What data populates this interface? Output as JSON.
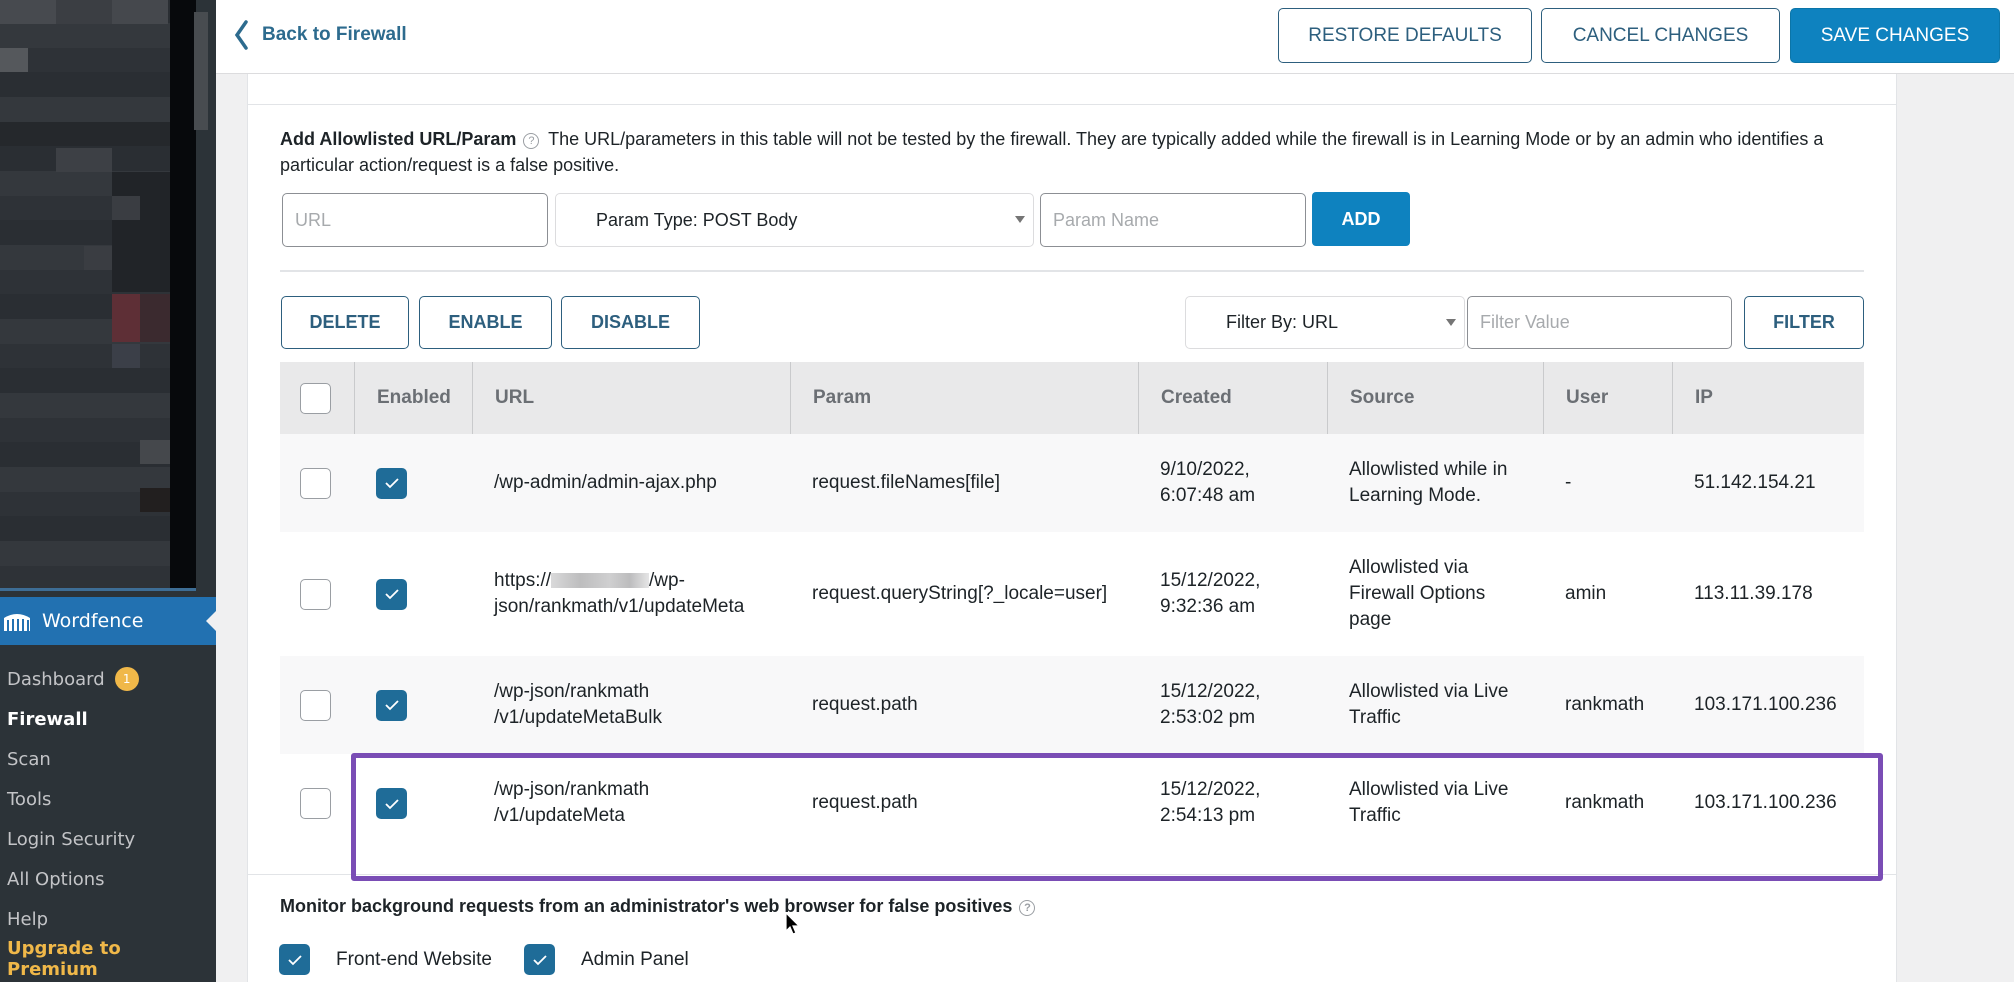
{
  "sidebar": {
    "plugin_name": "Wordfence",
    "items": [
      {
        "label": "Dashboard",
        "badge": "1"
      },
      {
        "label": "Firewall",
        "active": true
      },
      {
        "label": "Scan"
      },
      {
        "label": "Tools"
      },
      {
        "label": "Login Security"
      },
      {
        "label": "All Options"
      },
      {
        "label": "Help"
      },
      {
        "label": "Upgrade to Premium",
        "highlight": true
      }
    ]
  },
  "topbar": {
    "back_label": "Back to Firewall",
    "restore_label": "RESTORE DEFAULTS",
    "cancel_label": "CANCEL CHANGES",
    "save_label": "SAVE CHANGES"
  },
  "allowlist": {
    "title": "Add Allowlisted URL/Param",
    "help_glyph": "?",
    "description": "The URL/parameters in this table will not be tested by the firewall. They are typically added while the firewall is in Learning Mode or by an admin who identifies a particular action/request is a false positive.",
    "url_placeholder": "URL",
    "param_type_selected": "Param Type: POST Body",
    "param_name_placeholder": "Param Name",
    "add_label": "ADD"
  },
  "table_actions": {
    "delete_label": "DELETE",
    "enable_label": "ENABLE",
    "disable_label": "DISABLE",
    "filter_by_selected": "Filter By: URL",
    "filter_value_placeholder": "Filter Value",
    "filter_label": "FILTER"
  },
  "table": {
    "columns": [
      "",
      "Enabled",
      "URL",
      "Param",
      "Created",
      "Source",
      "User",
      "IP"
    ],
    "rows": [
      {
        "selected": false,
        "enabled": true,
        "url_line1": "/wp-admin/admin-ajax.php",
        "url_line2": "",
        "url_redacted": false,
        "param": "request.fileNames[file]",
        "created_line1": "9/10/2022,",
        "created_line2": "6:07:48 am",
        "source": "Allowlisted while in Learning Mode.",
        "user": "-",
        "ip": "51.142.154.21"
      },
      {
        "selected": false,
        "enabled": true,
        "url_line1_prefix": "https://",
        "url_line1_suffix": "/wp-",
        "url_line2": "json/rankmath/v1/updateMeta",
        "url_redacted": true,
        "param": "request.queryString[?_locale=user]",
        "created_line1": "15/12/2022,",
        "created_line2": "9:32:36 am",
        "source": "Allowlisted via Firewall Options page",
        "user": "amin",
        "ip": "113.11.39.178"
      },
      {
        "selected": false,
        "enabled": true,
        "url_line1": "/wp-json/rankmath",
        "url_line2": "/v1/updateMetaBulk",
        "url_redacted": false,
        "param": "request.path",
        "created_line1": "15/12/2022,",
        "created_line2": "2:53:02 pm",
        "source": "Allowlisted via Live Traffic",
        "user": "rankmath",
        "ip": "103.171.100.236"
      },
      {
        "selected": false,
        "enabled": true,
        "url_line1": "/wp-json/rankmath",
        "url_line2": "/v1/updateMeta",
        "url_redacted": false,
        "param": "request.path",
        "created_line1": "15/12/2022,",
        "created_line2": "2:54:13 pm",
        "source": "Allowlisted via Live Traffic",
        "user": "rankmath",
        "ip": "103.171.100.236",
        "highlighted": true
      }
    ]
  },
  "monitor": {
    "title": "Monitor background requests from an administrator's web browser for false positives",
    "options": [
      {
        "label": "Front-end Website",
        "checked": true
      },
      {
        "label": "Admin Panel",
        "checked": true
      }
    ]
  },
  "colors": {
    "primary": "#0e82bf",
    "outline": "#2d5f7e",
    "checkbox": "#1f6c98",
    "highlight": "#7a4db5",
    "sidebar_bg": "#2c3338",
    "sidebar_active": "#2271b1",
    "badge": "#f0b849"
  }
}
